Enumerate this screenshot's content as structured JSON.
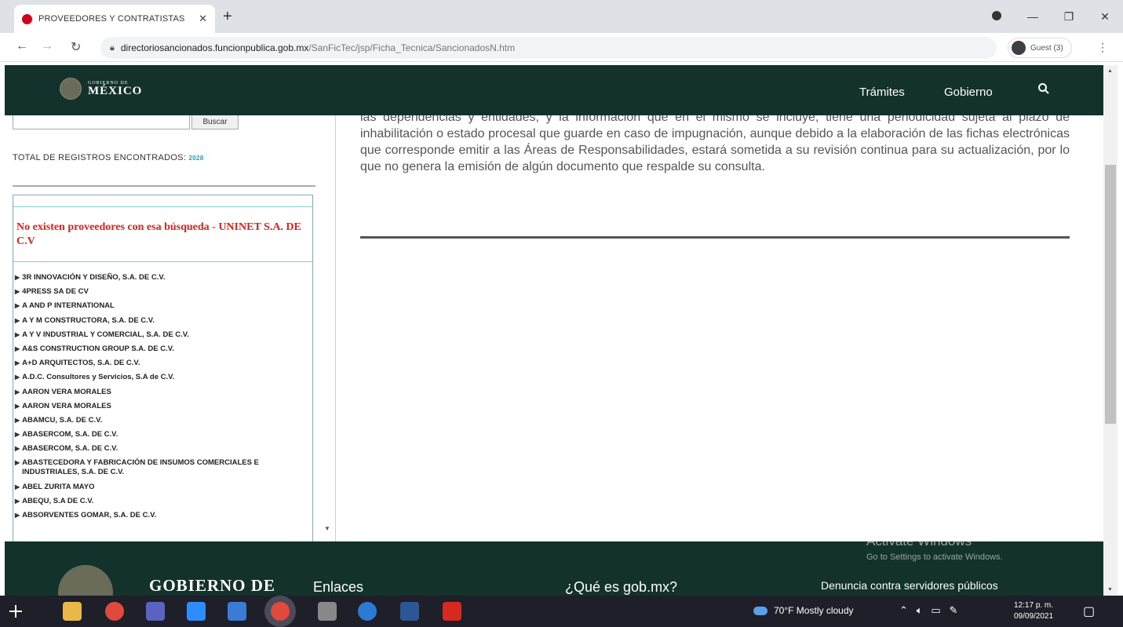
{
  "browser": {
    "tab_title": "PROVEEDORES Y CONTRATISTAS",
    "tab_close": "✕",
    "new_tab": "+",
    "url_host": "directoriosancionados.funcionpublica.gob.mx",
    "url_path": "/SanFicTec/jsp/Ficha_Tecnica/SancionadosN.htm",
    "profile_label": "Guest (3)"
  },
  "header": {
    "logo_small": "GOBIERNO DE",
    "logo_big": "MÉXICO",
    "nav": [
      "Trámites",
      "Gobierno"
    ]
  },
  "sidebar": {
    "search_button": "Buscar",
    "total_label": "TOTAL DE REGISTROS ENCONTRADOS:",
    "total_count": "2028",
    "no_result_message": "No existen proveedores con esa búsqueda - UNINET S.A. DE C.V",
    "providers": [
      "3R INNOVACIÓN Y DISEÑO, S.A. DE C.V.",
      "4PRESS SA DE CV",
      "A AND P INTERNATIONAL",
      "A Y M CONSTRUCTORA, S.A. DE C.V.",
      "A Y V INDUSTRIAL Y COMERCIAL, S.A. DE C.V.",
      "A&S CONSTRUCTION GROUP S.A. DE C.V.",
      "A+D ARQUITECTOS, S.A. DE C.V.",
      "A.D.C. Consultores y Servicios, S.A de C.V.",
      "AARON VERA MORALES",
      "AARON VERA MORALES",
      "ABAMCU, S.A. DE C.V.",
      "ABASERCOM, S.A. DE C.V.",
      "ABASERCOM, S.A. DE C.V.",
      "ABASTECEDORA Y FABRICACIÓN DE INSUMOS COMERCIALES E INDUSTRIALES, S.A. DE C.V.",
      "ABEL ZURITA MAYO",
      "ABEQU, S.A DE C.V.",
      "ABSORVENTES GOMAR, S.A. DE C.V."
    ]
  },
  "main": {
    "paragraph": "las dependencias y entidades, y la información que en el mismo se incluye, tiene una periodicidad sujeta al plazo de inhabilitación o estado procesal que guarde en caso de impugnación, aunque debido a la elaboración de las fichas electrónicas que corresponde emitir a las Áreas de Responsabilidades, estará sometida a su revisión continua para su actualización, por lo que no genera la emisión de algún documento que respalde su consulta."
  },
  "footer": {
    "brand": "GOBIERNO DE",
    "links": [
      "Enlaces",
      "¿Qué es gob.mx?"
    ],
    "denuncia": "Denuncia contra servidores públicos"
  },
  "watermark": {
    "line1": "Activate Windows",
    "line2": "Go to Settings to activate Windows."
  },
  "taskbar": {
    "weather": "70°F  Mostly cloudy",
    "time": "12:17 p. m.",
    "date": "09/09/2021"
  },
  "colors": {
    "header_bg": "#13322b",
    "no_result_red": "#e3201b",
    "count_blue": "#2aa0b8"
  }
}
